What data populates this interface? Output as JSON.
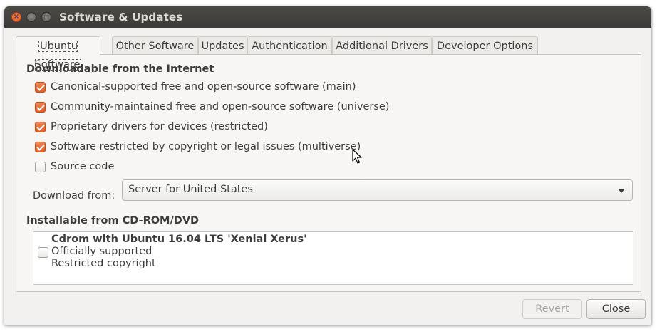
{
  "window": {
    "title": "Software & Updates"
  },
  "tabs": [
    {
      "label": "Ubuntu Software",
      "active": true
    },
    {
      "label": "Other Software",
      "active": false
    },
    {
      "label": "Updates",
      "active": false
    },
    {
      "label": "Authentication",
      "active": false
    },
    {
      "label": "Additional Drivers",
      "active": false
    },
    {
      "label": "Developer Options",
      "active": false
    }
  ],
  "internet": {
    "heading": "Downloadable from the Internet",
    "options": [
      {
        "label": "Canonical-supported free and open-source software (main)",
        "checked": true
      },
      {
        "label": "Community-maintained free and open-source software (universe)",
        "checked": true
      },
      {
        "label": "Proprietary drivers for devices (restricted)",
        "checked": true
      },
      {
        "label": "Software restricted by copyright or legal issues (multiverse)",
        "checked": true
      },
      {
        "label": "Source code",
        "checked": false
      }
    ],
    "download_from_label": "Download from:",
    "download_from_value": "Server for United States"
  },
  "cdrom": {
    "heading": "Installable from CD-ROM/DVD",
    "item": {
      "title": "Cdrom with Ubuntu 16.04 LTS 'Xenial Xerus'",
      "line1": "Officially supported",
      "line2": "Restricted copyright",
      "checked": false
    }
  },
  "buttons": {
    "revert": "Revert",
    "close": "Close"
  },
  "icons": {
    "close": "close-icon",
    "minimize": "minimize-icon",
    "maximize": "maximize-icon",
    "dropdown": "chevron-down-icon",
    "pointer": "mouse-pointer-icon"
  },
  "colors": {
    "accent": "#e15d23",
    "titlebar": "#3c3b37"
  }
}
